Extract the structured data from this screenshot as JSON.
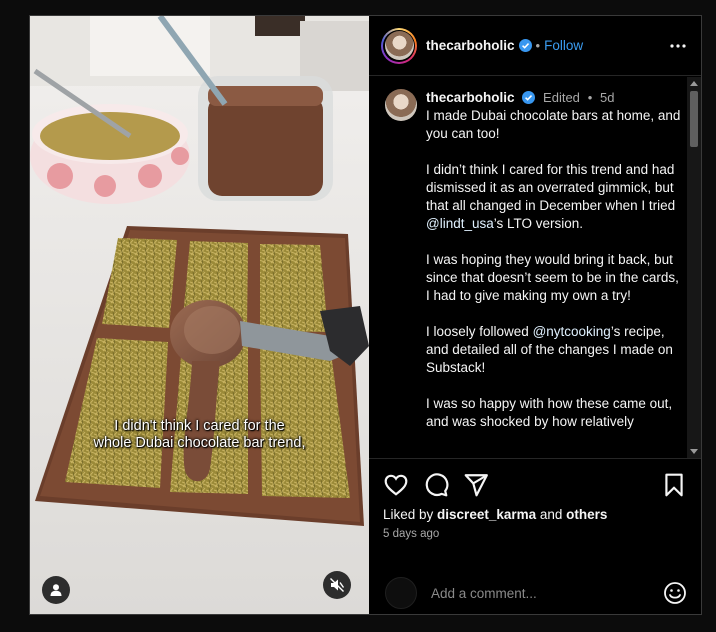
{
  "post": {
    "username": "thecarboholic",
    "follow_label": "Follow",
    "dot": "•",
    "video_caption_lines": [
      "I didn't think I cared for the",
      "whole Dubai chocolate bar trend,"
    ]
  },
  "comment": {
    "username": "thecarboholic",
    "edited_label": "Edited",
    "dot": "•",
    "time": "5d",
    "paragraphs": {
      "p1": "I made Dubai chocolate bars at home, and you can too!",
      "p2_before": "I didn’t think I cared for this trend and had dismissed it as an overrated gimmick, but that all changed in December when I tried ",
      "p2_mention": "@lindt_usa",
      "p2_after": "’s LTO version.",
      "p3": "I was hoping they would bring it back, but since that doesn’t seem to be in the cards, I had to give making my own a try!",
      "p4_before": "I loosely followed ",
      "p4_mention": "@nytcooking",
      "p4_after": "’s recipe, and detailed all of the changes I made on Substack!",
      "p5": "I was so happy with how these came out, and was shocked by how relatively"
    }
  },
  "actions": {
    "liked_by_prefix": "Liked by ",
    "liked_by_user": "discreet_karma",
    "liked_by_and": " and ",
    "liked_by_others": "others",
    "time_ago": "5 days ago"
  },
  "add_comment": {
    "placeholder": "Add a comment..."
  },
  "colors": {
    "accent": "#3b9cf0",
    "background": "#000000",
    "muted_text": "#a8a8a8",
    "verified_badge": "#3897f0"
  },
  "icons": [
    "user-tag-icon",
    "mute-icon",
    "more-options-icon",
    "verified-badge-icon",
    "heart-icon",
    "comment-icon",
    "share-icon",
    "bookmark-icon",
    "emoji-icon"
  ]
}
